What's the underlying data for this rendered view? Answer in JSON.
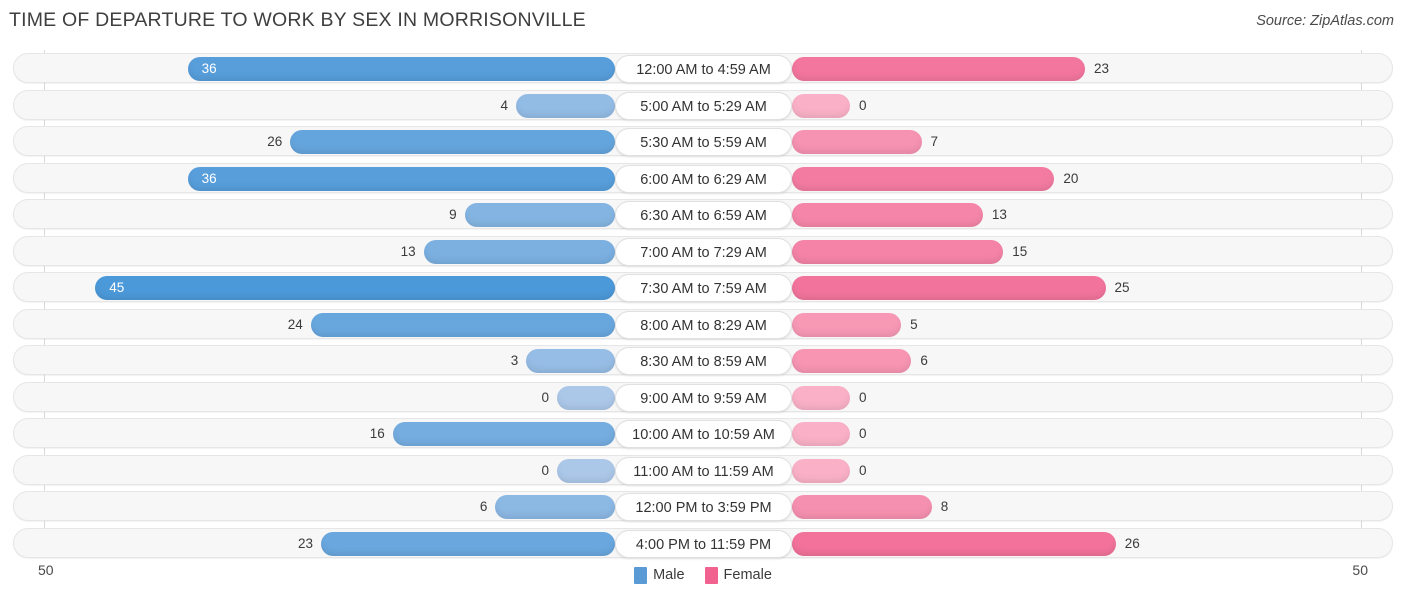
{
  "header": {
    "title": "TIME OF DEPARTURE TO WORK BY SEX IN MORRISONVILLE",
    "source": "Source: ZipAtlas.com"
  },
  "legend": {
    "male_label": "Male",
    "female_label": "Female",
    "male_color": "#5b9bd5",
    "female_color": "#f2628f"
  },
  "axis": {
    "left_max": "50",
    "right_max": "50"
  },
  "chart_data": {
    "type": "bar",
    "subtype": "diverging-bidirectional",
    "title": "TIME OF DEPARTURE TO WORK BY SEX IN MORRISONVILLE",
    "xlabel": "",
    "ylabel": "",
    "xlim": [
      50,
      50
    ],
    "axis_max": 50,
    "grid": false,
    "legend_position": "bottom-center",
    "categories": [
      "12:00 AM to 4:59 AM",
      "5:00 AM to 5:29 AM",
      "5:30 AM to 5:59 AM",
      "6:00 AM to 6:29 AM",
      "6:30 AM to 6:59 AM",
      "7:00 AM to 7:29 AM",
      "7:30 AM to 7:59 AM",
      "8:00 AM to 8:29 AM",
      "8:30 AM to 8:59 AM",
      "9:00 AM to 9:59 AM",
      "10:00 AM to 10:59 AM",
      "11:00 AM to 11:59 AM",
      "12:00 PM to 3:59 PM",
      "4:00 PM to 11:59 PM"
    ],
    "series": [
      {
        "name": "Male",
        "direction": "left",
        "color": "#5b9bd5",
        "values": [
          36,
          4,
          26,
          36,
          9,
          13,
          45,
          24,
          3,
          0,
          16,
          0,
          6,
          23
        ]
      },
      {
        "name": "Female",
        "direction": "right",
        "color": "#f2628f",
        "values": [
          23,
          0,
          7,
          20,
          13,
          15,
          25,
          5,
          6,
          0,
          0,
          0,
          8,
          26
        ]
      }
    ]
  }
}
